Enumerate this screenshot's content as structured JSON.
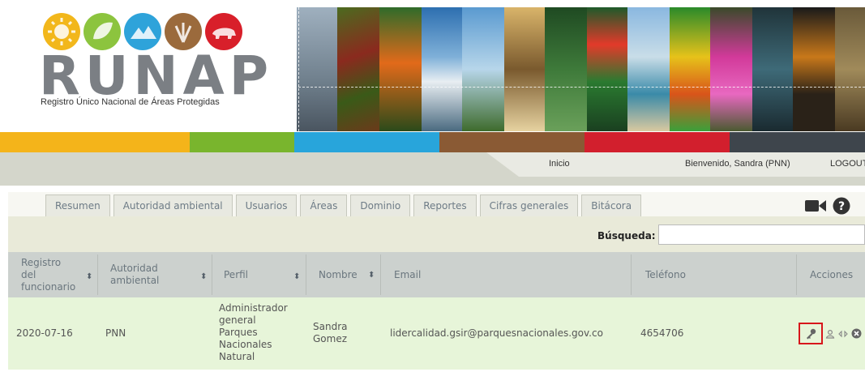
{
  "logo": {
    "word": "RUNAP",
    "subtitle": "Registro Único Nacional de Áreas Protegidas",
    "circle_colors": [
      "#f2b71b",
      "#8cc43e",
      "#2ea3da",
      "#9b6a3c",
      "#d81f2a"
    ]
  },
  "colorbar": [
    "#f4b41a",
    "#79b52d",
    "#28a5db",
    "#8a5a34",
    "#d21f2d",
    "#3e454c"
  ],
  "nav": {
    "home": "Inicio",
    "welcome": "Bienvenido, Sandra (PNN)",
    "logout": "LOGOUT"
  },
  "tabs": [
    {
      "label": "Resumen"
    },
    {
      "label": "Autoridad ambiental"
    },
    {
      "label": "Usuarios"
    },
    {
      "label": "Áreas"
    },
    {
      "label": "Dominio"
    },
    {
      "label": "Reportes"
    },
    {
      "label": "Cifras generales"
    },
    {
      "label": "Bitácora"
    }
  ],
  "tab_icons": [
    "video-camera-icon",
    "help-icon"
  ],
  "search": {
    "label": "Búsqueda:",
    "value": ""
  },
  "table": {
    "headers": [
      {
        "label": "Registro\ndel\nfuncionario",
        "sortable": true
      },
      {
        "label": "Autoridad\nambiental",
        "sortable": true
      },
      {
        "label": "Perfil",
        "sortable": true
      },
      {
        "label": "Nombre",
        "sortable": true
      },
      {
        "label": "Email",
        "sortable": false
      },
      {
        "label": "Teléfono",
        "sortable": false
      },
      {
        "label": "Acciones",
        "sortable": false
      }
    ],
    "rows": [
      {
        "registro": "2020-07-16",
        "autoridad": "PNN",
        "perfil": "Administrador\ngeneral\nParques\nNacionales\nNatural",
        "nombre": "Sandra\nGomez",
        "email": "lidercalidad.gsir@parquesnacionales.gov.co",
        "telefono": "4654706",
        "actions": [
          "key-icon",
          "user-icon",
          "transfer-icon",
          "delete-icon"
        ]
      }
    ]
  },
  "colors": {
    "header_row": "#ccd1ce",
    "data_row": "#e7f5d9",
    "highlight": "#d7161b"
  }
}
